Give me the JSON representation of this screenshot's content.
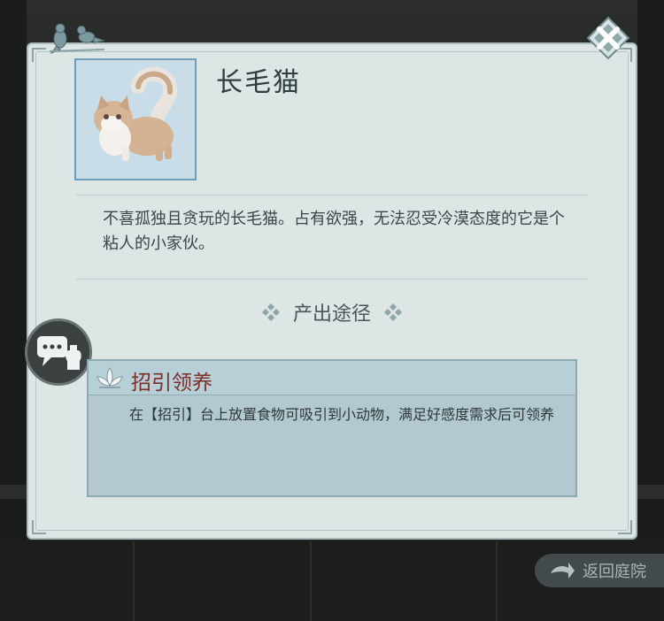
{
  "item": {
    "name": "长毛猫",
    "description": "不喜孤独且贪玩的长毛猫。占有欲强，无法忍受冷漠态度的它是个粘人的小家伙。"
  },
  "section": {
    "title": "产出途径"
  },
  "source": {
    "name": "招引领养",
    "detail": "在【招引】台上放置食物可吸引到小动物，满足好感度需求后可领养"
  },
  "return_button": {
    "label": "返回庭院"
  },
  "colors": {
    "panel_bg": "#dde5e5",
    "source_name": "#7b2d26",
    "portrait_border": "#6f9cb8"
  },
  "icons": [
    "birds-icon",
    "close-icon",
    "diamond-icon",
    "chat-icon",
    "lotus-icon",
    "return-arrow-icon"
  ]
}
